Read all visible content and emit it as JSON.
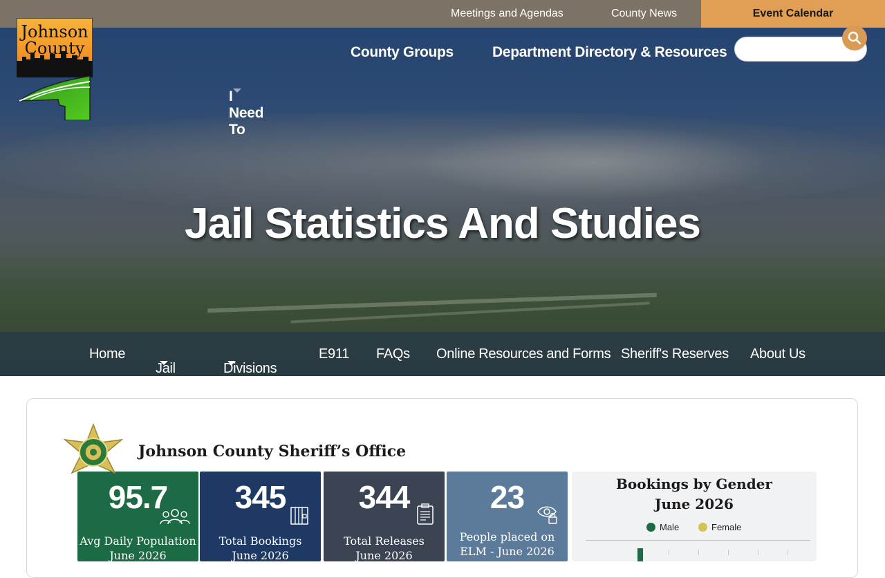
{
  "topbar": {
    "links": [
      "Meetings and Agendas",
      "County News"
    ],
    "cta": "Event Calendar"
  },
  "logo": {
    "line1": "Johnson",
    "line2": "County"
  },
  "main_nav": {
    "items": [
      "I Need To",
      "County Groups",
      "Department Directory & Resources"
    ]
  },
  "search": {
    "placeholder": "",
    "icon": "search-icon"
  },
  "hero": {
    "title": "Jail Statistics And Studies"
  },
  "sub_nav": {
    "items": [
      "Home",
      "Jail",
      "Divisions",
      "E911",
      "FAQs",
      "Online Resources and Forms",
      "Sheriff's Reserves",
      "About Us"
    ]
  },
  "dashboard": {
    "org_title": "Johnson County Sheriff’s Office",
    "tiles": [
      {
        "value": "95.7",
        "label_line1": "Avg Daily Population",
        "label_line2": "June 2026",
        "icon": "people-icon",
        "color": "#1d6b45"
      },
      {
        "value": "345",
        "label_line1": "Total Bookings",
        "label_line2": "June 2026",
        "icon": "jail-cell-icon",
        "color": "#1e3a64"
      },
      {
        "value": "344",
        "label_line1": "Total Releases",
        "label_line2": "June 2026",
        "icon": "release-document-icon",
        "color": "#3a4452"
      },
      {
        "value": "23",
        "label_line1": "People placed on",
        "label_line2": "ELM - June 2026",
        "icon": "monitoring-eye-lock-icon",
        "color": "#5c7a99"
      }
    ],
    "gender_chart": {
      "title_line1": "Bookings by Gender",
      "title_line2": "June 2026",
      "legend": [
        {
          "name": "Male",
          "color": "#1d6b45"
        },
        {
          "name": "Female",
          "color": "#d4c25a"
        }
      ]
    }
  },
  "colors": {
    "topbar": "#7d7266",
    "accent_orange": "#e09f55",
    "hero_overlay": "#25446f"
  }
}
